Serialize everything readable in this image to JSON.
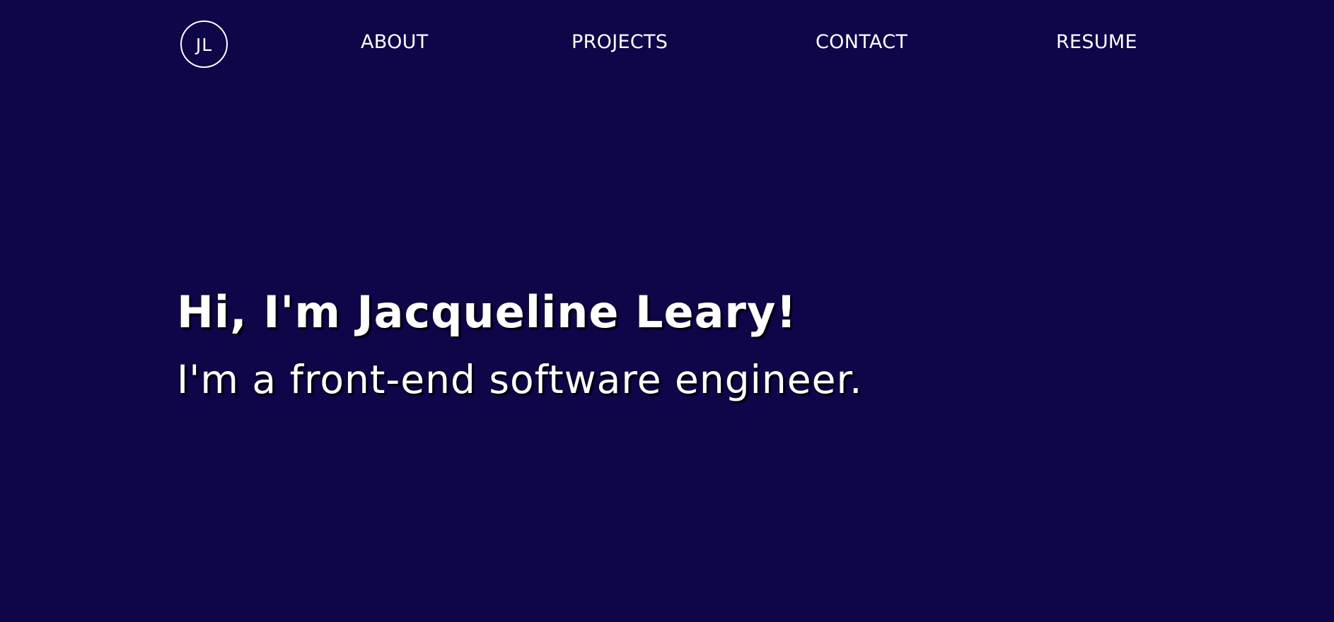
{
  "colors": {
    "background": "#0e0649",
    "text": "#ffffff"
  },
  "nav": {
    "logo_text": "JL",
    "links": [
      {
        "label": "ABOUT"
      },
      {
        "label": "PROJECTS"
      },
      {
        "label": "CONTACT"
      },
      {
        "label": "RESUME"
      }
    ]
  },
  "hero": {
    "title": "Hi, I'm Jacqueline Leary!",
    "subtitle": "I'm a front-end software engineer."
  }
}
